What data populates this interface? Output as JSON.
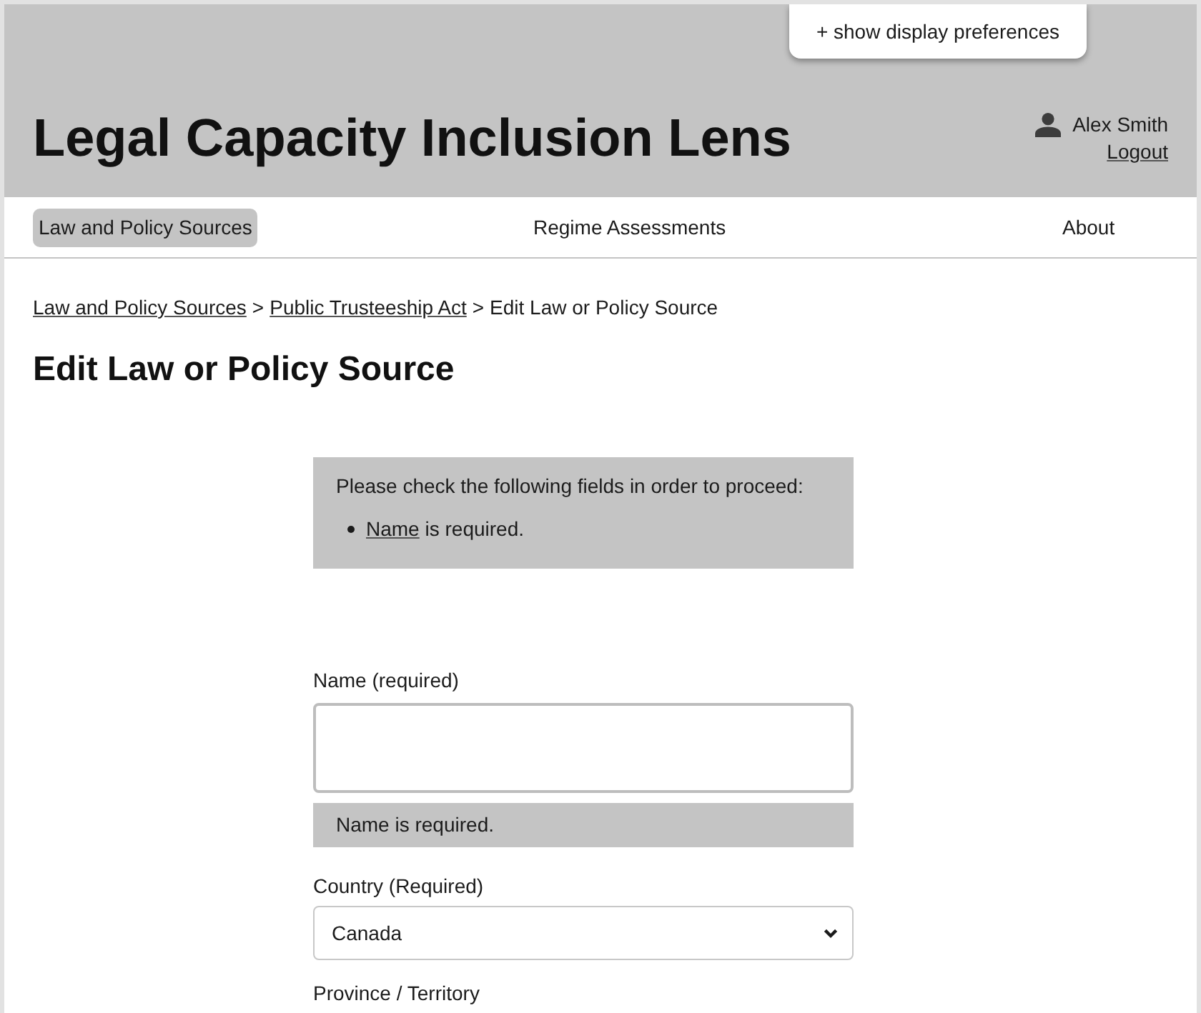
{
  "display_preferences_button": "+ show display preferences",
  "app_title": "Legal Capacity Inclusion Lens",
  "user": {
    "name": "Alex Smith",
    "logout": "Logout"
  },
  "nav": [
    {
      "label": "Law and Policy Sources",
      "selected": true
    },
    {
      "label": "Regime Assessments",
      "selected": false
    },
    {
      "label": "About",
      "selected": false
    }
  ],
  "breadcrumb": [
    {
      "kind": "link",
      "label": "Law and Policy Sources"
    },
    {
      "kind": "separator",
      "label": ">"
    },
    {
      "kind": "link",
      "label": "Public Trusteeship Act"
    },
    {
      "kind": "separator",
      "label": ">"
    },
    {
      "kind": "current",
      "label": "Edit Law or Policy Source"
    }
  ],
  "page_title": "Edit Law or Policy Source",
  "error_summary": {
    "heading": "Please check the following fields in order to proceed:",
    "items": [
      {
        "field": "Name",
        "message": "is required."
      }
    ]
  },
  "fields": [
    {
      "kind": "text",
      "label": "Name (required)",
      "error": "Name is required."
    },
    {
      "kind": "select",
      "label": "Country (Required)",
      "value": "Canada"
    },
    {
      "kind": "label",
      "label": "Province / Territory"
    }
  ]
}
